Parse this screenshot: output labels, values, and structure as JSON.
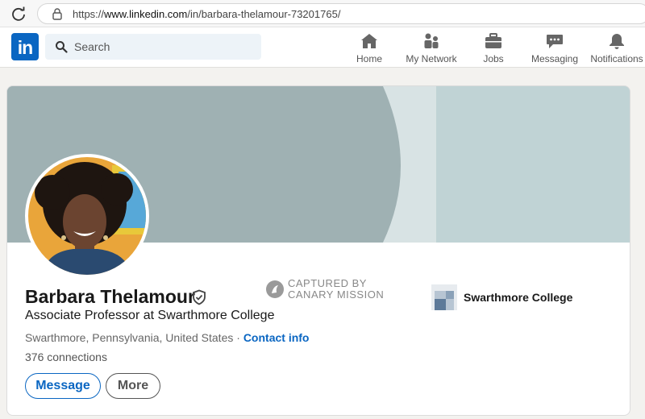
{
  "browser": {
    "url_prefix": "https://",
    "url_domain": "www.linkedin.com",
    "url_path": "/in/barbara-thelamour-73201765/"
  },
  "nav": {
    "logo_text": "in",
    "search_placeholder": "Search",
    "items": [
      {
        "label": "Home",
        "icon": "home-icon"
      },
      {
        "label": "My Network",
        "icon": "network-icon"
      },
      {
        "label": "Jobs",
        "icon": "briefcase-icon"
      },
      {
        "label": "Messaging",
        "icon": "chat-icon"
      },
      {
        "label": "Notifications",
        "icon": "bell-icon"
      }
    ]
  },
  "profile": {
    "name": "Barbara Thelamour",
    "headline": "Associate Professor at Swarthmore College",
    "location": "Swarthmore, Pennsylvania, United States",
    "separator": " · ",
    "contact_label": "Contact info",
    "connections": "376 connections",
    "message_label": "Message",
    "more_label": "More",
    "education": "Swarthmore College"
  },
  "watermark": {
    "line1": "CAPTURED BY",
    "line2": "CANARY MISSION"
  },
  "colors": {
    "brand": "#0a66c2",
    "banner": "#9fb1b3",
    "banner_light": "#c0d3d5"
  }
}
